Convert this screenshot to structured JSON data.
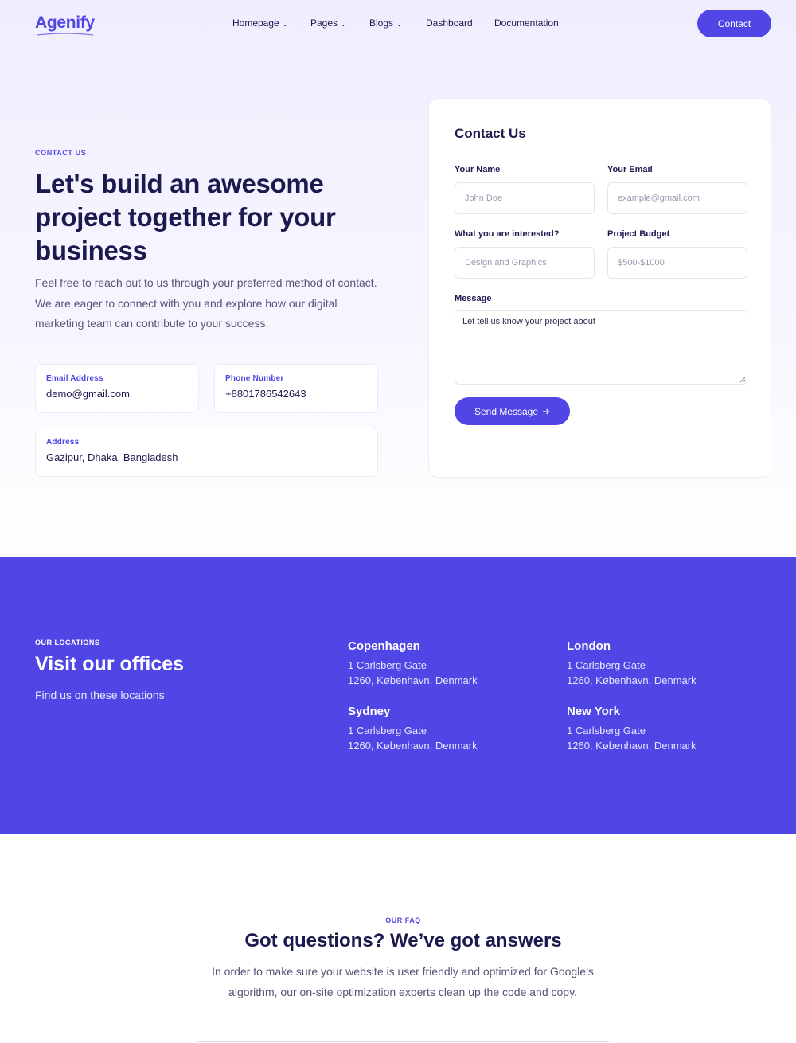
{
  "header": {
    "logo": "Agenify",
    "nav": [
      {
        "label": "Homepage",
        "has_dropdown": true
      },
      {
        "label": "Pages",
        "has_dropdown": true
      },
      {
        "label": "Blogs",
        "has_dropdown": true
      },
      {
        "label": "Dashboard",
        "has_dropdown": false
      },
      {
        "label": "Documentation",
        "has_dropdown": false
      }
    ],
    "contact_button": "Contact"
  },
  "hero": {
    "eyebrow": "CONTACT US",
    "title": "Let's build an awesome project together for your business",
    "description": "Feel free to reach out to us through your preferred method of contact. We are eager to connect with you and explore how our digital marketing team can contribute to your success.",
    "email": {
      "label": "Email Address",
      "value": "demo@gmail.com"
    },
    "phone": {
      "label": "Phone Number",
      "value": "+8801786542643"
    },
    "address": {
      "label": "Address",
      "value": "Gazipur, Dhaka, Bangladesh"
    }
  },
  "form": {
    "title": "Contact Us",
    "name": {
      "label": "Your Name",
      "placeholder": "John Doe"
    },
    "email": {
      "label": "Your Email",
      "placeholder": "example@gmail.com"
    },
    "interest": {
      "label": "What you are interested?",
      "placeholder": "Design and Graphics"
    },
    "budget": {
      "label": "Project Budget",
      "placeholder": "$500-$1000"
    },
    "message": {
      "label": "Message",
      "placeholder": "Let tell us know your project about"
    },
    "submit": "Send Message"
  },
  "locations": {
    "eyebrow": "OUR LOCATIONS",
    "title": "Visit our offices",
    "subtitle": "Find us on these locations",
    "offices": [
      {
        "city": "Copenhagen",
        "line1": "1 Carlsberg Gate",
        "line2": "1260, København, Denmark"
      },
      {
        "city": "London",
        "line1": "1 Carlsberg Gate",
        "line2": "1260, København, Denmark"
      },
      {
        "city": "Sydney",
        "line1": "1 Carlsberg Gate",
        "line2": "1260, København, Denmark"
      },
      {
        "city": "New York",
        "line1": "1 Carlsberg Gate",
        "line2": "1260, København, Denmark"
      }
    ]
  },
  "faq": {
    "eyebrow": "OUR FAQ",
    "title": "Got questions? We’ve got answers",
    "description": "In order to make sure your website is user friendly and optimized for Google’s algorithm, our on-site optimization experts clean up the code and copy."
  },
  "colors": {
    "accent": "#4f46e5",
    "heading": "#1b1a4e",
    "body": "#545477"
  }
}
